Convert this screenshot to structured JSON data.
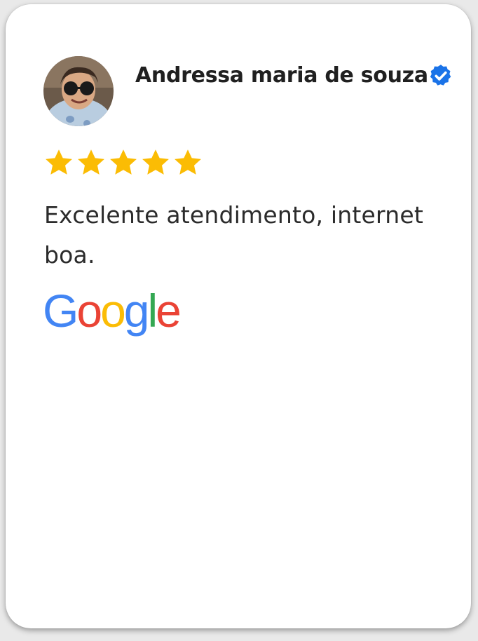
{
  "reviewer": {
    "name": "Andressa maria de souza",
    "verified": true,
    "avatar_icon": "user-avatar-photo"
  },
  "rating": {
    "value": 5,
    "max": 5,
    "star_color": "#FBBC04"
  },
  "review": {
    "text": "Excelente atendimento, internet boa."
  },
  "source": {
    "logo_text": "Google",
    "logo_letters": [
      {
        "char": "G",
        "color": "#4285F4"
      },
      {
        "char": "o",
        "color": "#EA4335"
      },
      {
        "char": "o",
        "color": "#FBBC05"
      },
      {
        "char": "g",
        "color": "#4285F4"
      },
      {
        "char": "l",
        "color": "#34A853"
      },
      {
        "char": "e",
        "color": "#EA4335"
      }
    ]
  },
  "colors": {
    "verified_badge": "#1A73E8",
    "card_background": "#FFFFFF"
  }
}
